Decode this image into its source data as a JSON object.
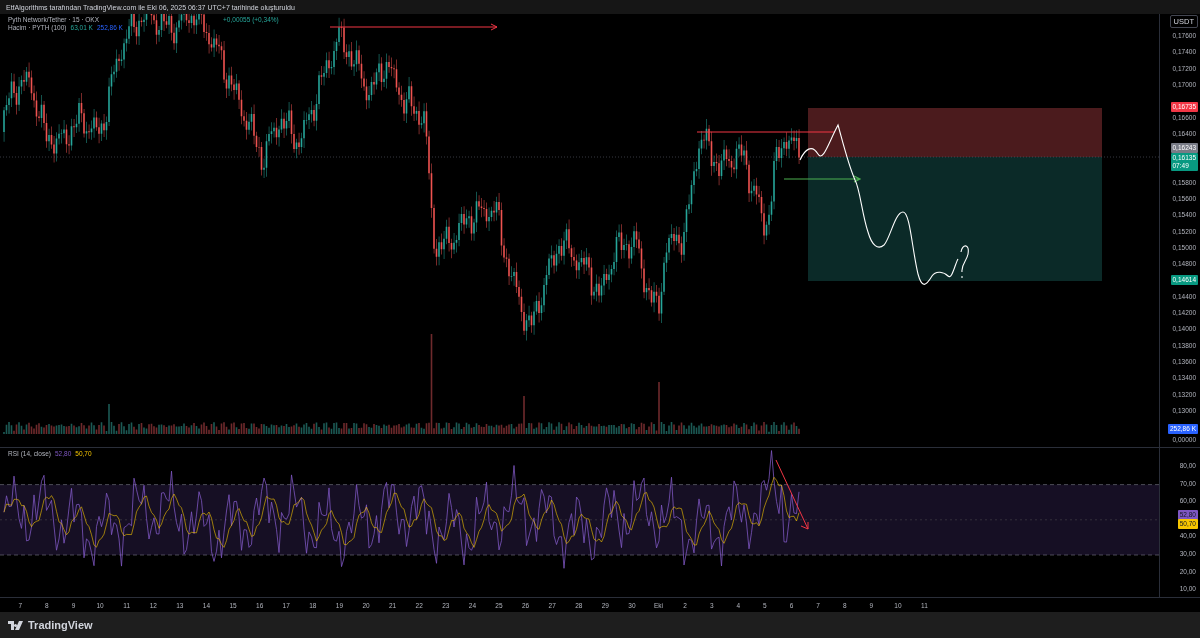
{
  "header": {
    "text": "EtfAlgorithms tarafından TradingView.com ile Eki 06, 2025 06:37 UTC+7 tarihinde oluşturuldu"
  },
  "legend": {
    "symbol": "Pyth Network/Tether · 15 · OKX",
    "change": "+0,00055 (+0,34%)"
  },
  "volume_legend": {
    "title": "Hacim · PYTH (100)",
    "values": [
      "63,01 K",
      "252,86 K"
    ]
  },
  "price_axis": {
    "unit": "USDT",
    "ticks": [
      "0,17600",
      "0,17400",
      "0,17200",
      "0,17000",
      "0,16600",
      "0,16400",
      "0,15800",
      "0,15600",
      "0,15400",
      "0,15200",
      "0,15000",
      "0,14800",
      "0,14400",
      "0,14200",
      "0,14000",
      "0,13800",
      "0,13600",
      "0,13400",
      "0,13200",
      "0,13000"
    ],
    "badges": [
      {
        "text": "0,16735",
        "color": "#f23645"
      },
      {
        "text": "0,16243",
        "color": "#787b86"
      },
      {
        "text": "0,16135",
        "countdown": "07:49",
        "color": "#089981"
      },
      {
        "text": "0,14614",
        "color": "#089981"
      }
    ],
    "volume_badge": {
      "text": "252,86 K",
      "color": "#2962ff"
    },
    "volume_tick": "0,00000"
  },
  "rsi": {
    "title": "RSI (14, close)",
    "values": [
      "52,80",
      "50,70"
    ],
    "ticks": [
      "80,00",
      "70,00",
      "60,00",
      "40,00",
      "30,00",
      "20,00",
      "10,00"
    ],
    "badges": [
      {
        "text": "52,80",
        "color": "#7e57c2"
      },
      {
        "text": "50,70",
        "color": "#f7c600"
      }
    ]
  },
  "time_axis": [
    "7",
    "8",
    "9",
    "10",
    "11",
    "12",
    "13",
    "14",
    "15",
    "16",
    "17",
    "18",
    "19",
    "20",
    "21",
    "22",
    "23",
    "24",
    "25",
    "26",
    "27",
    "28",
    "29",
    "30",
    "Eki",
    "2",
    "3",
    "4",
    "5",
    "6",
    "7",
    "8",
    "9",
    "10",
    "11"
  ],
  "footer": {
    "brand": "TradingView"
  }
}
